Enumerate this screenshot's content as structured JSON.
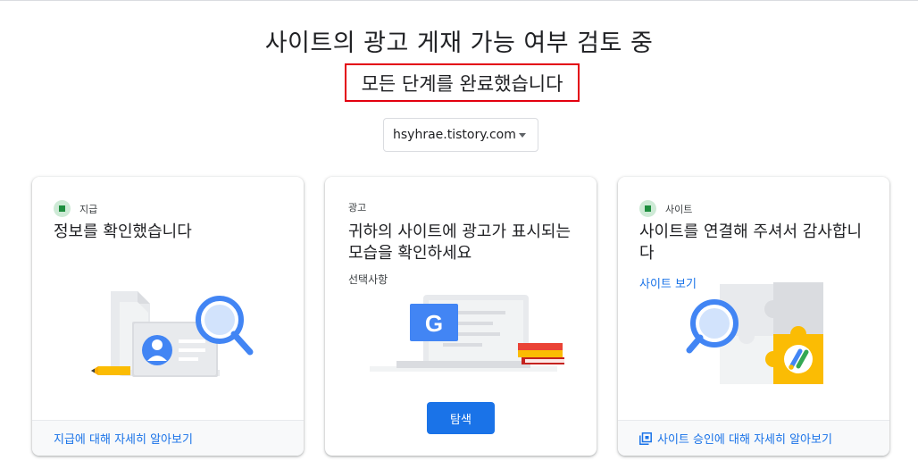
{
  "header": {
    "title": "사이트의 광고 게재 가능 여부 검토 중",
    "subtitle": "모든 단계를 완료했습니다"
  },
  "site_selector": {
    "value": "hsyhrae.tistory.com",
    "icon": "dropdown-caret-icon"
  },
  "cards": [
    {
      "category": "지급",
      "status_icon": "check-status-icon",
      "heading": "정보를 확인했습니다",
      "illustration": "payment-document-illustration",
      "footer_link": "지급에 대해 자세히 알아보기"
    },
    {
      "category": "광고",
      "heading": "귀하의 사이트에 광고가 표시되는 모습을 확인하세요",
      "optional_label": "선택사항",
      "illustration": "ads-preview-illustration",
      "button_label": "탐색"
    },
    {
      "category": "사이트",
      "status_icon": "check-status-icon",
      "heading": "사이트를 연결해 주셔서 감사합니다",
      "link_label": "사이트 보기",
      "illustration": "site-connect-puzzle-illustration",
      "footer_link": "사이트 승인에 대해 자세히 알아보기",
      "footer_icon": "external-pages-icon"
    }
  ],
  "colors": {
    "accent": "#1a73e8",
    "status_green": "#1e8e3e",
    "highlight_border": "#e3000f"
  }
}
